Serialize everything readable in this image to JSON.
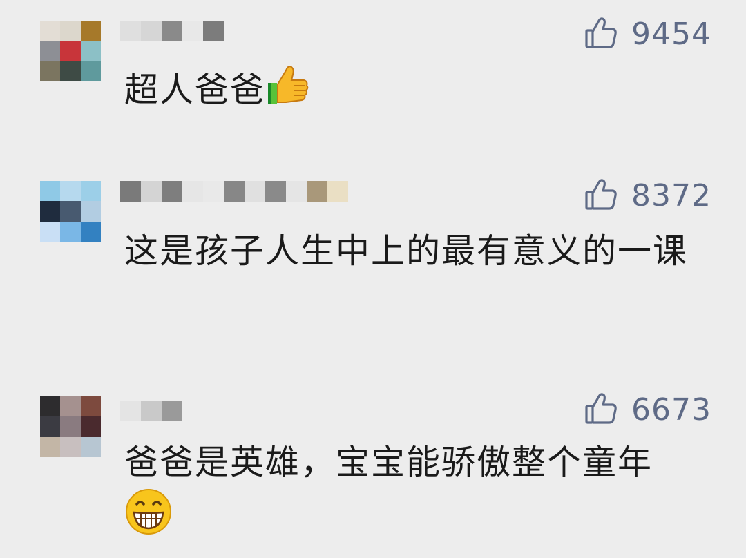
{
  "comments": [
    {
      "likes": "9454",
      "text": "超人爸爸",
      "emoji": "thumbs-up-icon",
      "avatar_colors": [
        "#e3ddd5",
        "#dcd7cc",
        "#a6792a",
        "#8d8f95",
        "#c8353a",
        "#8cc0c6",
        "#7b7560",
        "#3e4b45",
        "#5f9a9d"
      ],
      "nick_colors": [
        "#dfdfdf",
        "#d6d6d6",
        "#8a8a8a",
        "#e8e8e8",
        "#7c7c7c"
      ]
    },
    {
      "likes": "8372",
      "text": "这是孩子人生中上的最有意义的一课",
      "emoji": "",
      "avatar_colors": [
        "#8fc9e6",
        "#b6d9ee",
        "#9ccfe8",
        "#1f2c3e",
        "#485a70",
        "#b2cde2",
        "#c9dff5",
        "#7ab7e6",
        "#3381c1"
      ],
      "nick_colors": [
        "#7a7a7a",
        "#d4d4d4",
        "#7e7e7e",
        "#e6e6e6",
        "#e9e9e9",
        "#878787",
        "#e0e0e0",
        "#8a8a8a",
        "#e5e5e5",
        "#a9987a",
        "#eadfc4"
      ]
    },
    {
      "likes": "6673",
      "text": "爸爸是英雄，宝宝能骄傲整个童年",
      "emoji": "grinning-face-icon",
      "avatar_colors": [
        "#2d2c2e",
        "#a5918f",
        "#7d4a3e",
        "#3b3b42",
        "#8a7b80",
        "#4a2a2e",
        "#c3b6a6",
        "#c8bfbf",
        "#b7c6d2"
      ],
      "nick_colors": [
        "#e4e4e4",
        "#c9c9c9",
        "#9a9a9a"
      ]
    }
  ]
}
